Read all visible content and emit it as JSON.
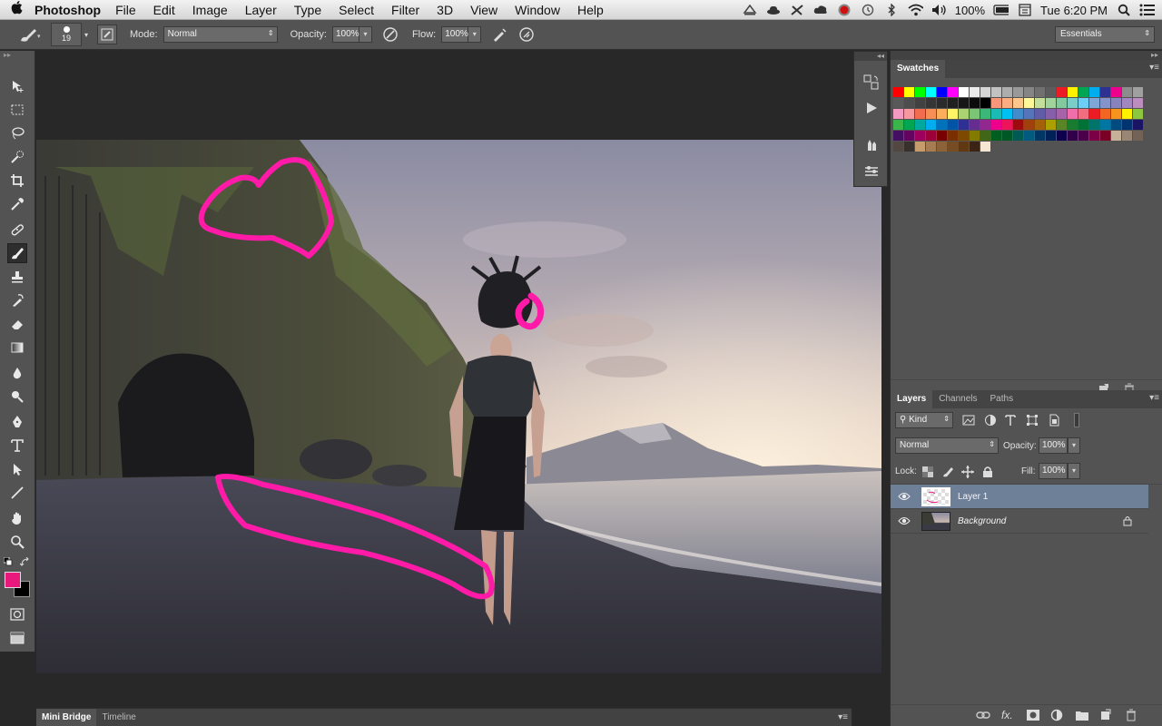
{
  "menubar": {
    "app_name": "Photoshop",
    "items": [
      "File",
      "Edit",
      "Image",
      "Layer",
      "Type",
      "Select",
      "Filter",
      "3D",
      "View",
      "Window",
      "Help"
    ],
    "battery": "100%",
    "clock": "Tue 6:20 PM"
  },
  "options": {
    "brush_size": "19",
    "mode_label": "Mode:",
    "mode_value": "Normal",
    "opacity_label": "Opacity:",
    "opacity_value": "100%",
    "flow_label": "Flow:",
    "flow_value": "100%",
    "workspace": "Essentials"
  },
  "colors": {
    "foreground": "#e8187c",
    "background": "#000000",
    "brush_stroke": "#ff1aa8"
  },
  "swatches": {
    "title": "Swatches",
    "colors": [
      "#ff0000",
      "#ffff00",
      "#00ff00",
      "#00ffff",
      "#0000ff",
      "#ff00ff",
      "#ffffff",
      "#ebebeb",
      "#d6d6d6",
      "#c2c2c2",
      "#adadad",
      "#999999",
      "#858585",
      "#707070",
      "#5c5c5c",
      "#ed1c24",
      "#fff200",
      "#00a651",
      "#00aeef",
      "#2e3192",
      "#ec008c",
      "#8c8c8c",
      "#a0a0a0",
      "#595959",
      "#4d4d4d",
      "#414141",
      "#363636",
      "#2b2b2b",
      "#202020",
      "#161616",
      "#0b0b0b",
      "#000000",
      "#f7977a",
      "#f9ad81",
      "#fdc68a",
      "#fff79a",
      "#c4df9b",
      "#a3d39c",
      "#82ca9d",
      "#7bcdc8",
      "#6ecff6",
      "#7ea7d8",
      "#8493ca",
      "#8882be",
      "#a187be",
      "#bc8dbf",
      "#f49ac2",
      "#f6989d",
      "#f26c4f",
      "#f68e55",
      "#fbaf5c",
      "#fff467",
      "#acd372",
      "#7cc576",
      "#3bb878",
      "#1abbb4",
      "#00bff3",
      "#438ccb",
      "#5574b9",
      "#605ca8",
      "#855fa8",
      "#a763a8",
      "#f06ea9",
      "#f26d7d",
      "#ed1c24",
      "#f26522",
      "#f7941d",
      "#fff200",
      "#8dc63f",
      "#39b54a",
      "#00a651",
      "#00a99d",
      "#00aeef",
      "#0072bc",
      "#0054a6",
      "#2e3192",
      "#662d91",
      "#92278f",
      "#ec008c",
      "#ed145b",
      "#9e0b0f",
      "#a0410d",
      "#a36209",
      "#aba000",
      "#598527",
      "#197b30",
      "#007236",
      "#00746b",
      "#0076a3",
      "#004b80",
      "#003471",
      "#1b1464",
      "#440e62",
      "#630460",
      "#9e005d",
      "#9e0039",
      "#790000",
      "#7b2e00",
      "#7d4900",
      "#827b00",
      "#406618",
      "#005e20",
      "#005826",
      "#005952",
      "#005b7f",
      "#003663",
      "#002157",
      "#0d004c",
      "#32004b",
      "#4b0049",
      "#7b0046",
      "#7a0026",
      "#c7b299",
      "#998675",
      "#736357",
      "#534741",
      "#37302d",
      "#c69c6d",
      "#a67c52",
      "#8c6239",
      "#754c24",
      "#603913",
      "#3c2415",
      "#f5e6d3"
    ]
  },
  "layers_panel": {
    "tabs": [
      "Layers",
      "Channels",
      "Paths"
    ],
    "kind_label": "Kind",
    "blend_mode": "Normal",
    "opacity_label": "Opacity:",
    "opacity_value": "100%",
    "lock_label": "Lock:",
    "fill_label": "Fill:",
    "fill_value": "100%",
    "layers": [
      {
        "name": "Layer 1",
        "selected": true,
        "locked": false,
        "italic": false
      },
      {
        "name": "Background",
        "selected": false,
        "locked": true,
        "italic": true
      }
    ]
  },
  "bottom_panel": {
    "tabs": [
      "Mini Bridge",
      "Timeline"
    ]
  }
}
